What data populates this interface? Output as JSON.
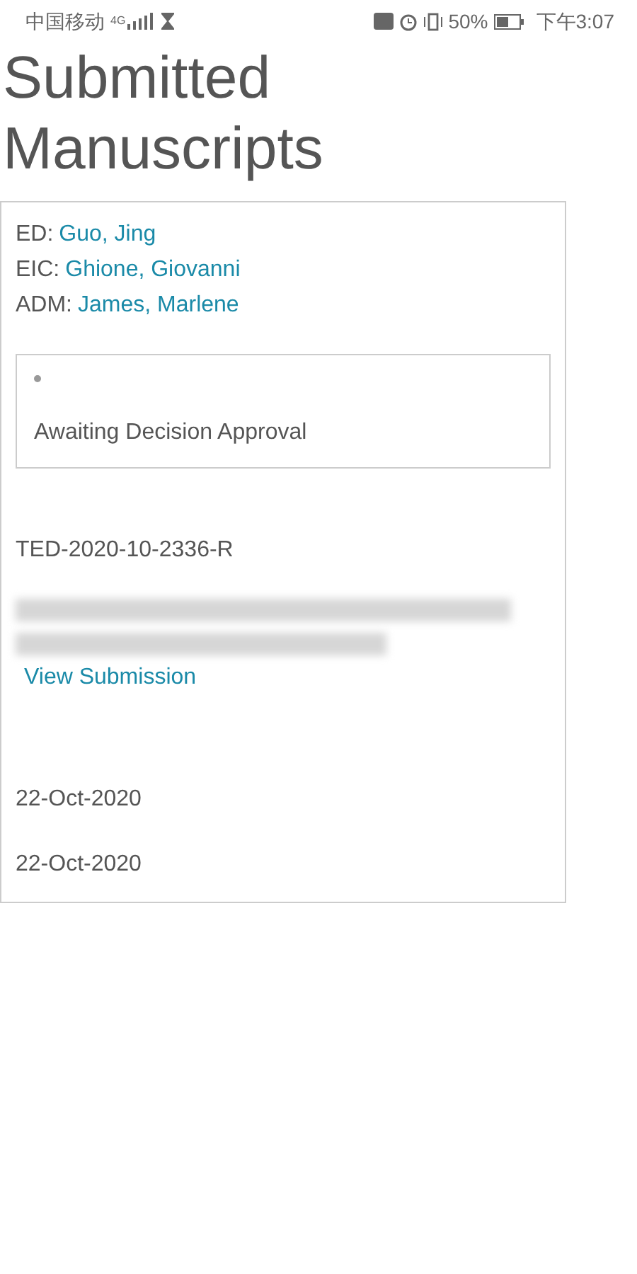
{
  "status_bar": {
    "carrier": "中国移动",
    "network": "4G",
    "battery": "50%",
    "time": "下午3:07"
  },
  "title": "Submitted Manuscripts",
  "card": {
    "editors": [
      {
        "role": "ED:",
        "name": "Guo, Jing"
      },
      {
        "role": "EIC:",
        "name": "Ghione, Giovanni"
      },
      {
        "role": "ADM:",
        "name": "James, Marlene"
      }
    ],
    "status": "Awaiting Decision Approval",
    "manuscript_id": "TED-2020-10-2336-R",
    "manuscript_title": {
      "kind": "blurred"
    },
    "link": "View Submission",
    "dates": [
      "22-Oct-2020",
      "22-Oct-2020"
    ]
  }
}
